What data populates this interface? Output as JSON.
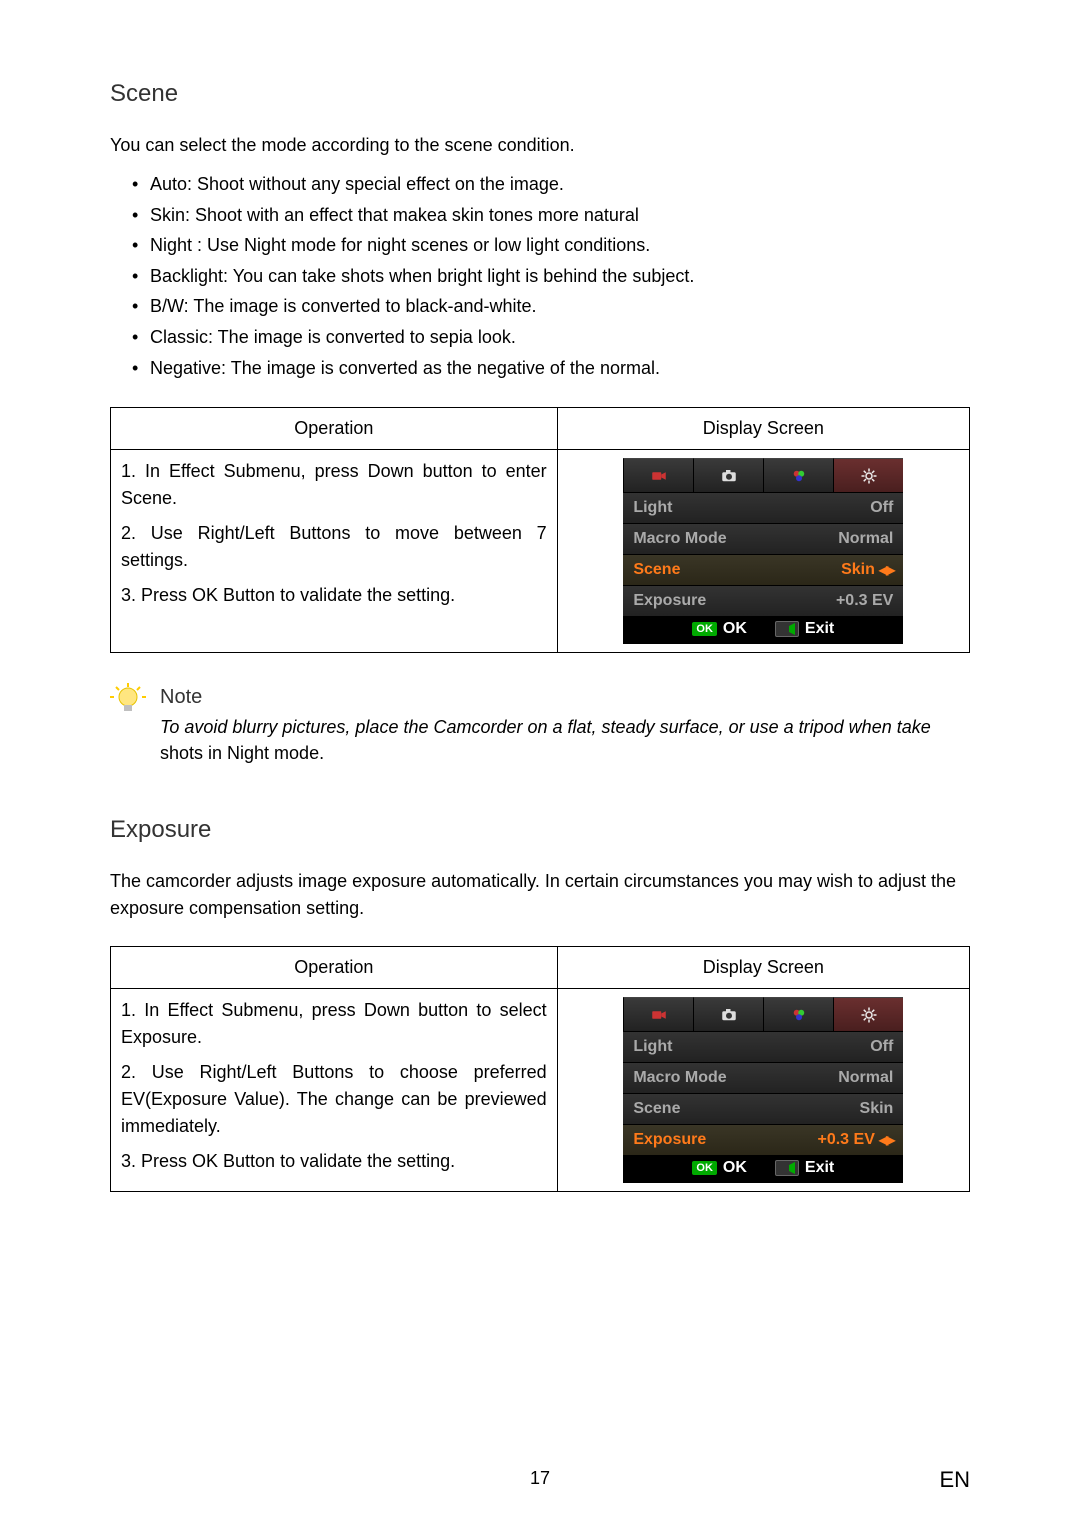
{
  "page_number": "17",
  "language_tag": "EN",
  "scene": {
    "title": "Scene",
    "intro": "You can select the mode according to the scene condition.",
    "bullets": [
      "Auto:  Shoot without any special effect on the image.",
      "Skin:  Shoot with an effect that makea skin tones more natural",
      "Night : Use Night mode for night scenes or low light conditions.",
      "Backlight:   You can take shots when bright light is behind the subject.",
      "B/W: The image is converted to black-and-white.",
      "Classic:  The image is converted to sepia look.",
      "Negative:  The image is converted as the negative of the normal."
    ],
    "table": {
      "headers": {
        "operation": "Operation",
        "display": "Display Screen"
      },
      "steps": [
        "1. In Effect Submenu, press Down button to enter Scene.",
        "2. Use Right/Left Buttons to move between 7 settings.",
        "3. Press OK Button to validate the setting."
      ]
    },
    "screen": {
      "tabs": [
        "video-icon",
        "photo-icon",
        "effect-icon",
        "settings-icon"
      ],
      "active_tab": 3,
      "rows": [
        {
          "label": "Light",
          "value": "Off",
          "highlight": false
        },
        {
          "label": "Macro Mode",
          "value": "Normal",
          "highlight": false
        },
        {
          "label": "Scene",
          "value": "Skin",
          "highlight": true,
          "arrows": true
        },
        {
          "label": "Exposure",
          "value": "+0.3 EV",
          "highlight": false
        }
      ],
      "footer": {
        "ok": "OK",
        "exit": "Exit"
      }
    }
  },
  "note": {
    "title": "Note",
    "text_italic": "To avoid blurry pictures, place the Camcorder on a flat, steady surface, or use a tripod when take",
    "text_plain": " shots in Night mode."
  },
  "exposure": {
    "title": "Exposure",
    "intro": "The camcorder adjusts image exposure automatically. In certain circumstances you may wish to adjust the exposure compensation setting.",
    "table": {
      "headers": {
        "operation": "Operation",
        "display": "Display Screen"
      },
      "steps": [
        "1. In Effect Submenu, press Down button to select Exposure.",
        "2. Use Right/Left Buttons to choose preferred EV(Exposure Value). The change can be previewed immediately.",
        "3. Press OK Button to validate the setting."
      ]
    },
    "screen": {
      "tabs": [
        "video-icon",
        "photo-icon",
        "effect-icon",
        "settings-icon"
      ],
      "active_tab": 3,
      "rows": [
        {
          "label": "Light",
          "value": "Off",
          "highlight": false
        },
        {
          "label": "Macro Mode",
          "value": "Normal",
          "highlight": false
        },
        {
          "label": "Scene",
          "value": "Skin",
          "highlight": false
        },
        {
          "label": "Exposure",
          "value": "+0.3 EV",
          "highlight": true,
          "arrows": true
        }
      ],
      "footer": {
        "ok": "OK",
        "exit": "Exit"
      }
    }
  }
}
